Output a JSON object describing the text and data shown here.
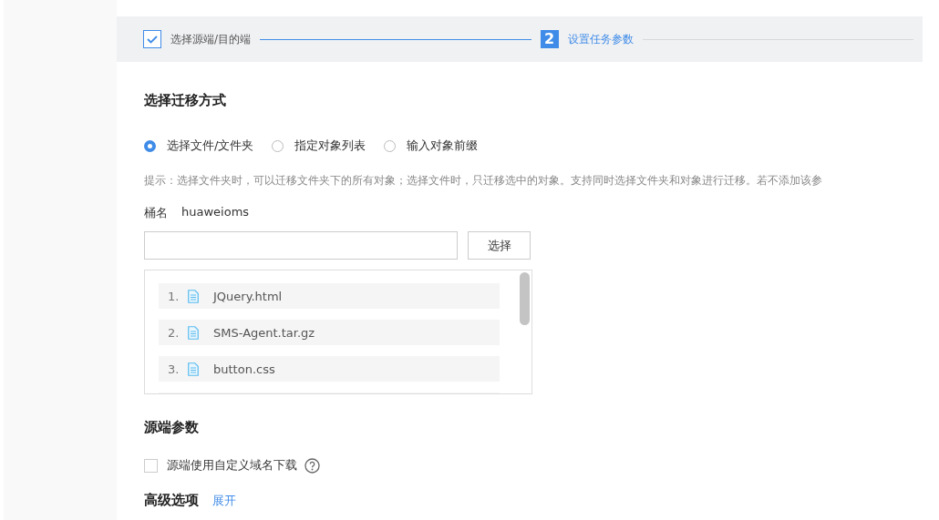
{
  "steps": [
    {
      "label": "选择源端/目的端",
      "done": true,
      "selected": false
    },
    {
      "label": "设置任务参数",
      "done": false,
      "number": "2",
      "selected": true
    }
  ],
  "migration": {
    "title": "选择迁移方式",
    "options": [
      {
        "label": "选择文件/文件夹",
        "selected": true
      },
      {
        "label": "指定对象列表",
        "selected": false
      },
      {
        "label": "输入对象前缀",
        "selected": false
      }
    ],
    "hint": "提示：选择文件夹时，可以迁移文件夹下的所有对象；选择文件时，只迁移选中的对象。支持同时选择文件夹和对象进行迁移。若不添加该参",
    "bucket_label": "桶名",
    "bucket_name": "huaweioms",
    "select_button": "选择",
    "files": [
      {
        "index": "1.",
        "name": "JQuery.html"
      },
      {
        "index": "2.",
        "name": "SMS-Agent.tar.gz"
      },
      {
        "index": "3.",
        "name": "button.css"
      }
    ]
  },
  "source": {
    "title": "源端参数",
    "custom_domain": {
      "label": "源端使用自定义域名下载",
      "checked": false
    }
  },
  "advanced": {
    "title": "高级选项",
    "toggle": "展开"
  }
}
